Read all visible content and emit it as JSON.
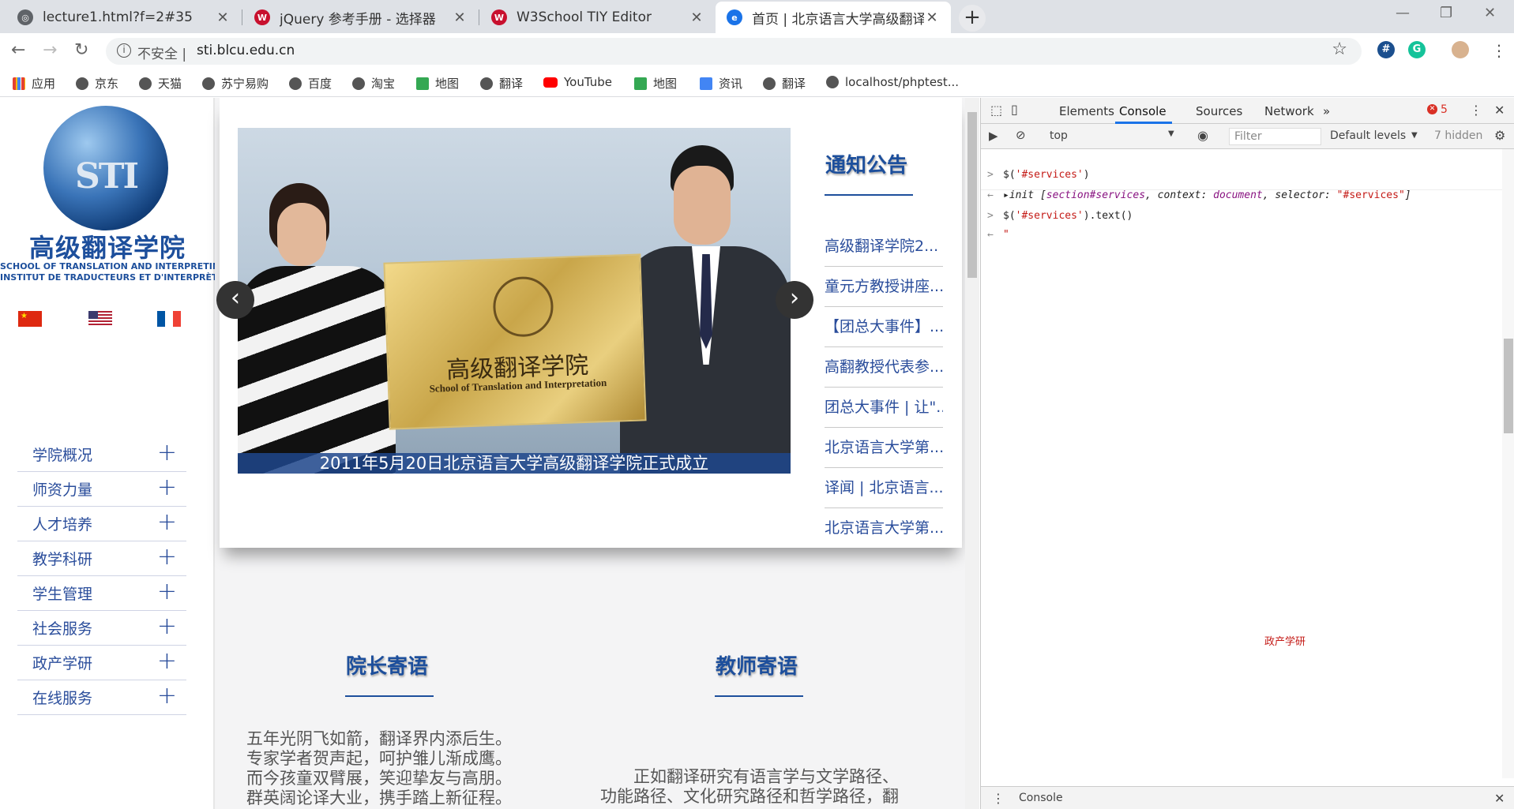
{
  "browser": {
    "tabs": [
      {
        "title": "lecture1.html?f=2#35",
        "close": "✕"
      },
      {
        "title": "jQuery 参考手册 - 选择器",
        "close": "✕"
      },
      {
        "title": "W3School TIY Editor",
        "close": "✕"
      },
      {
        "title": "首页 | 北京语言大学高级翻译学院",
        "close": "✕"
      }
    ],
    "new_tab": "+",
    "window_controls": {
      "minimize": "—",
      "restore": "❐",
      "close": "✕"
    },
    "nav": {
      "back": "←",
      "forward": "→",
      "reload": "↻"
    },
    "address": {
      "info_icon": "i",
      "security_label": "不安全",
      "separator": "|",
      "url": "sti.blcu.edu.cn",
      "star": "☆"
    },
    "extensions": [
      {
        "name": "hash-extension-icon",
        "glyph": "#",
        "color": "#1b4f8e"
      },
      {
        "name": "grammarly-extension-icon",
        "glyph": "G",
        "color": "#15c39a"
      },
      {
        "name": "profile-avatar-icon",
        "glyph": "",
        "color": "#d8b28f"
      }
    ],
    "menu": "⋮",
    "bookmarks": [
      {
        "label": "应用",
        "icon": "apps-grid-icon",
        "color": "#e34133"
      },
      {
        "label": "京东",
        "icon": "globe-icon",
        "color": "#555555"
      },
      {
        "label": "天猫",
        "icon": "globe-icon",
        "color": "#555555"
      },
      {
        "label": "苏宁易购",
        "icon": "globe-icon",
        "color": "#555555"
      },
      {
        "label": "百度",
        "icon": "globe-icon",
        "color": "#555555"
      },
      {
        "label": "淘宝",
        "icon": "globe-icon",
        "color": "#555555"
      },
      {
        "label": "地图",
        "icon": "maps-icon",
        "color": "#34a853"
      },
      {
        "label": "翻译",
        "icon": "globe-icon",
        "color": "#555555"
      },
      {
        "label": "YouTube",
        "icon": "youtube-icon",
        "color": "#ff0000"
      },
      {
        "label": "地图",
        "icon": "maps-icon",
        "color": "#34a853"
      },
      {
        "label": "资讯",
        "icon": "news-icon",
        "color": "#4285f4"
      },
      {
        "label": "翻译",
        "icon": "globe-icon",
        "color": "#555555"
      },
      {
        "label": "localhost/phptest...",
        "icon": "globe-icon",
        "color": "#555555"
      }
    ]
  },
  "site": {
    "logo_text": "STI",
    "school_cn": "高级翻译学院",
    "school_en": "SCHOOL OF TRANSLATION AND INTERPRETING",
    "school_fr": "INSTITUT DE TRADUCTEURS ET D'INTERPRÈTES",
    "flags": [
      "china-flag-icon",
      "usa-flag-icon",
      "france-flag-icon"
    ],
    "menu": [
      {
        "label": "学院概况",
        "expand": "+"
      },
      {
        "label": "师资力量",
        "expand": "+"
      },
      {
        "label": "人才培养",
        "expand": "+"
      },
      {
        "label": "教学科研",
        "expand": "+"
      },
      {
        "label": "学生管理",
        "expand": "+"
      },
      {
        "label": "社会服务",
        "expand": "+"
      },
      {
        "label": "政产学研",
        "expand": "+"
      },
      {
        "label": "在线服务",
        "expand": "+"
      }
    ],
    "carousel": {
      "plaque_cn": "高级翻译学院",
      "plaque_en": "School of Translation and Interpretation",
      "caption": "2011年5月20日北京语言大学高级翻译学院正式成立",
      "prev": "‹",
      "next": "›"
    },
    "notices": {
      "title": "通知公告",
      "items": [
        "高级翻译学院2...",
        "童元方教授讲座...",
        "【团总大事件】...",
        "高翻教授代表参...",
        "团总大事件 | 让\"...",
        "北京语言大学第...",
        "译闻 | 北京语言...",
        "北京语言大学第..."
      ]
    },
    "dean": {
      "title": "院长寄语",
      "lines": [
        "五年光阴飞如箭，翻译界内添后生。",
        "专家学者贺声起，呵护雏儿渐成鹰。",
        "而今孩童双臂展，笑迎挚友与高朋。",
        "群英阔论译大业，携手踏上新征程。"
      ]
    },
    "teacher": {
      "title": "教师寄语",
      "lines": [
        "正如翻译研究有语言学与文学路径、",
        "功能路径、文化研究路径和哲学路径，翻"
      ]
    }
  },
  "devtools": {
    "tabs": [
      "Elements",
      "Console",
      "Sources",
      "Network",
      "»"
    ],
    "active_tab": "Console",
    "error_count": "5",
    "context": "top",
    "filter_placeholder": "Filter",
    "levels": "Default levels",
    "hidden": "7 hidden",
    "console": [
      {
        "gutter": ">",
        "parts": [
          {
            "t": "$(",
            "c": ""
          },
          {
            "t": "'#services'",
            "c": "str"
          },
          {
            "t": ")",
            "c": ""
          }
        ]
      },
      {
        "gutter": "←",
        "parts": [
          {
            "t": "▸init [",
            "c": "ital"
          },
          {
            "t": "section#services",
            "c": "kw"
          },
          {
            "t": ", context: ",
            "c": "ital"
          },
          {
            "t": "document",
            "c": "kw"
          },
          {
            "t": ", selector: ",
            "c": "ital"
          },
          {
            "t": "\"#services\"",
            "c": "str"
          },
          {
            "t": "]",
            "c": "ital"
          }
        ]
      },
      {
        "gutter": ">",
        "parts": [
          {
            "t": "$(",
            "c": ""
          },
          {
            "t": "'#services'",
            "c": "str"
          },
          {
            "t": ").text()",
            "c": ""
          }
        ]
      },
      {
        "gutter": "←",
        "parts": [
          {
            "t": "\"",
            "c": "str"
          }
        ]
      }
    ],
    "console_output_fragment": "政产学研",
    "drawer_label": "Console"
  }
}
